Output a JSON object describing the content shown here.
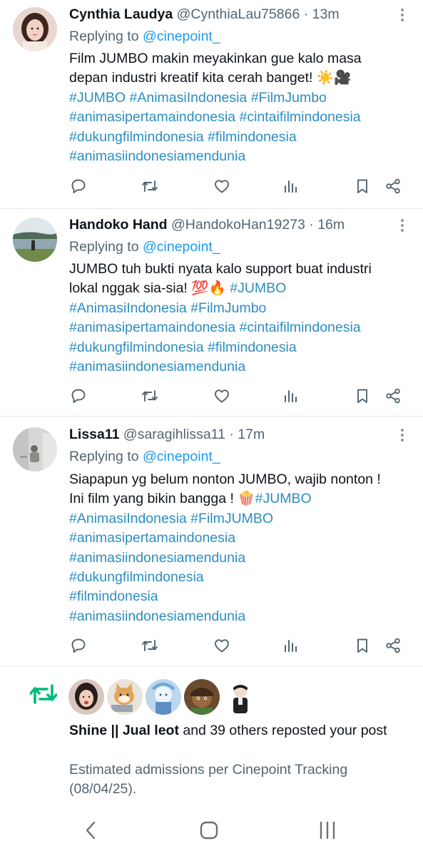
{
  "tweets": [
    {
      "name": "Cynthia Laudya",
      "handle": "@CynthiaLau75866",
      "time": "· 13m",
      "replying_prefix": "Replying to",
      "replying_handle": "@cinepoint_",
      "lines": [
        [
          {
            "t": "Film JUMBO makin meyakinkan gue kalo masa",
            "tag": false
          }
        ],
        [
          {
            "t": "depan industri kreatif kita cerah banget! ☀️🎥",
            "tag": false
          }
        ],
        [
          {
            "t": "#JUMBO #AnimasiIndonesia #FilmJumbo",
            "tag": true
          }
        ],
        [
          {
            "t": "#animasipertamaindonesia #cintaifilmindonesia",
            "tag": true
          }
        ],
        [
          {
            "t": "#dukungfilmindonesia #filmindonesia",
            "tag": true
          }
        ],
        [
          {
            "t": "#animasiindonesiamendunia",
            "tag": true
          }
        ]
      ]
    },
    {
      "name": "Handoko Hand",
      "handle": "@HandokoHan19273",
      "time": "· 16m",
      "replying_prefix": "Replying to",
      "replying_handle": "@cinepoint_",
      "lines": [
        [
          {
            "t": "JUMBO tuh bukti nyata kalo support buat industri",
            "tag": false
          }
        ],
        [
          {
            "t": "lokal nggak sia-sia! 💯🔥 ",
            "tag": false
          },
          {
            "t": "#JUMBO",
            "tag": true
          }
        ],
        [
          {
            "t": "#AnimasiIndonesia #FilmJumbo",
            "tag": true
          }
        ],
        [
          {
            "t": "#animasipertamaindonesia #cintaifilmindonesia",
            "tag": true
          }
        ],
        [
          {
            "t": "#dukungfilmindonesia #filmindonesia",
            "tag": true
          }
        ],
        [
          {
            "t": "#animasiindonesiamendunia",
            "tag": true
          }
        ]
      ]
    },
    {
      "name": "Lissa11",
      "handle": "@saragihlissa11",
      "time": "· 17m",
      "replying_prefix": "Replying to",
      "replying_handle": "@cinepoint_",
      "lines": [
        [
          {
            "t": "Siapapun yg belum nonton JUMBO, wajib nonton !",
            "tag": false
          }
        ],
        [
          {
            "t": "Ini film yang bikin bangga ! 🍿",
            "tag": false
          },
          {
            "t": "#JUMBO",
            "tag": true
          }
        ],
        [
          {
            "t": "#AnimasiIndonesia #FilmJUMBO",
            "tag": true
          }
        ],
        [
          {
            "t": "#animasipertamaindonesia",
            "tag": true
          }
        ],
        [
          {
            "t": "#animasiindonesiamendunia",
            "tag": true
          }
        ],
        [
          {
            "t": "#dukungfilmindonesia",
            "tag": true
          }
        ],
        [
          {
            "t": "#filmindonesia",
            "tag": true
          }
        ],
        [
          {
            "t": "#animasiindonesiamendunia",
            "tag": true
          }
        ]
      ]
    }
  ],
  "action_icons": [
    "reply-icon",
    "retweet-icon",
    "like-icon",
    "views-icon",
    "bookmark-icon",
    "share-icon"
  ],
  "repost_notice": {
    "names": "Shine || Jual leot",
    "rest": " and 39 others reposted your post",
    "subtext": "Estimated admissions per Cinepoint Tracking (08/04/25)."
  },
  "colors": {
    "accent": "#1d9bf0",
    "hashtag": "#2c8ec0",
    "muted": "#536471",
    "retweet_green": "#00ba7c",
    "icon": "#536471"
  },
  "navbar": [
    "back-nav-icon",
    "home-nav-icon",
    "recents-nav-icon"
  ]
}
